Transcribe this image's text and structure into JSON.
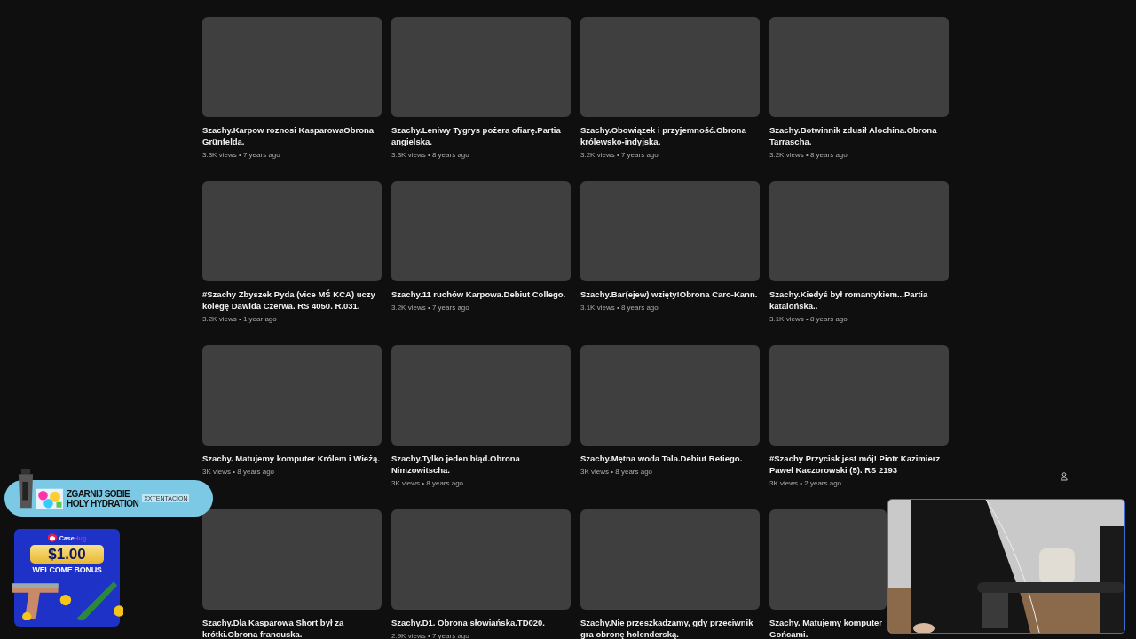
{
  "videos": [
    {
      "title": "Szachy.Karpow roznosi KasparowaObrona Grünfelda.",
      "meta": "3.3K views • 7 years ago"
    },
    {
      "title": "Szachy.Leniwy Tygrys pożera ofiarę.Partia angielska.",
      "meta": "3.3K views • 8 years ago"
    },
    {
      "title": "Szachy.Obowiązek i przyjemność.Obrona królewsko-indyjska.",
      "meta": "3.2K views • 7 years ago"
    },
    {
      "title": "Szachy.Botwinnik zdusił Alochina.Obrona Tarrascha.",
      "meta": "3.2K views • 8 years ago"
    },
    {
      "title": "#Szachy Zbyszek Pyda (vice MŚ KCA) uczy kolegę Dawida Czerwa. RS 4050. R.031.",
      "meta": "3.2K views • 1 year ago"
    },
    {
      "title": "Szachy.11 ruchów Karpowa.Debiut Collego.",
      "meta": "3.2K views • 7 years ago"
    },
    {
      "title": "Szachy.Bar(ejew) wzięty!Obrona Caro-Kann.",
      "meta": "3.1K views • 8 years ago"
    },
    {
      "title": "Szachy.Kiedyś był romantykiem...Partia katalońska..",
      "meta": "3.1K views • 8 years ago"
    },
    {
      "title": "Szachy. Matujemy komputer Królem i Wieżą.",
      "meta": "3K views • 8 years ago"
    },
    {
      "title": "Szachy.Tylko jeden błąd.Obrona Nimzowitscha.",
      "meta": "3K views • 8 years ago"
    },
    {
      "title": "Szachy.Mętna woda Tala.Debiut Retiego.",
      "meta": "3K views • 8 years ago"
    },
    {
      "title": "#Szachy Przycisk jest mój! Piotr Kazimierz Paweł Kaczorowski (5). RS 2193",
      "meta": "3K views • 2 years ago"
    },
    {
      "title": "Szachy.Dla Kasparowa Short był za krótki.Obrona francuska."
    },
    {
      "title": "Szachy.D1. Obrona słowiańska.TD020.",
      "meta": "2.9K views • 7 years ago"
    },
    {
      "title": "Szachy.Nie przeszkadzamy, gdy przeciwnik gra obronę holenderską."
    },
    {
      "title": "Szachy. Matujemy komputer\nGońcami.",
      "covered": true
    }
  ],
  "overlays": {
    "banner": {
      "headline_1": "ZGARNIJ SOBIE",
      "headline_2": "HOLY HYDRATION",
      "brand": "XXTENTACION"
    },
    "promo": {
      "brand_1": "Case",
      "brand_2": "Hug",
      "amount": "$1.00",
      "offer": "WELCOME BONUS"
    }
  }
}
